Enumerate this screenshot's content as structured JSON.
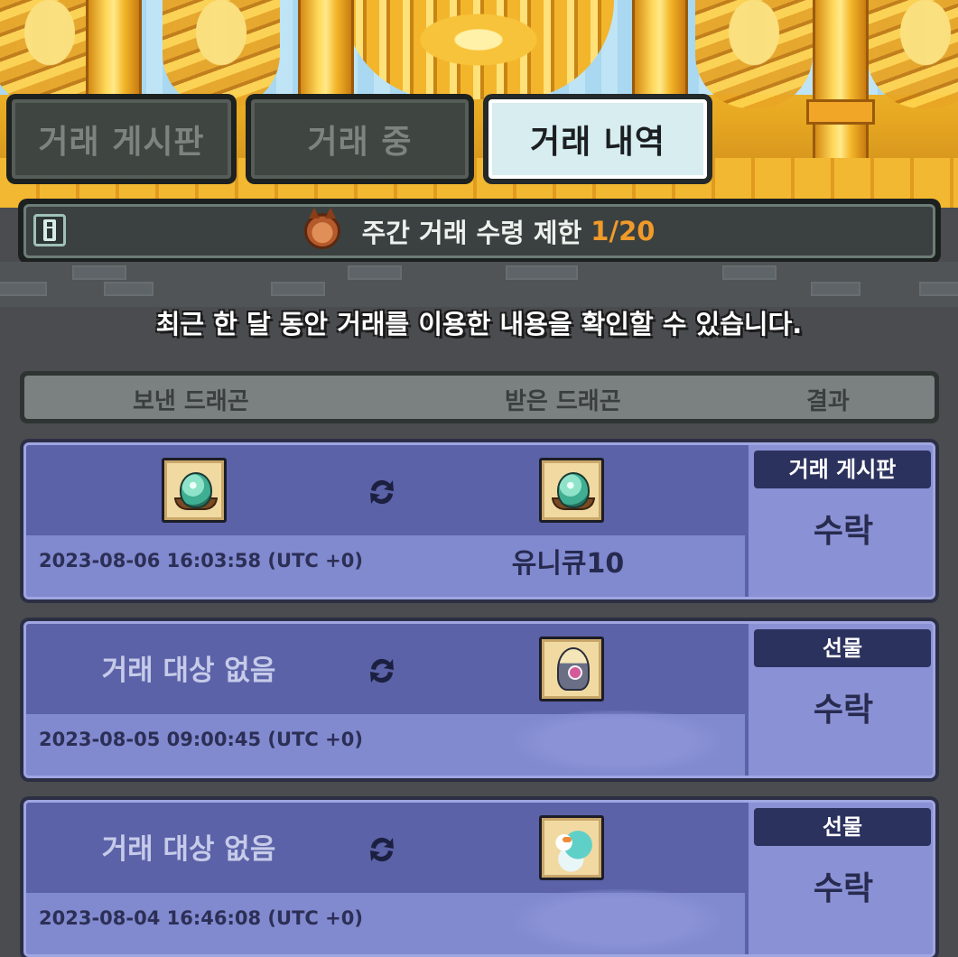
{
  "tabs": [
    {
      "label": "거래 게시판",
      "active": false
    },
    {
      "label": "거래 중",
      "active": false
    },
    {
      "label": "거래 내역",
      "active": true
    }
  ],
  "weekly_limit": {
    "label": "주간 거래 수령 제한",
    "value": "1/20",
    "value_color": "#f19a2a"
  },
  "notice": "최근 한 달 동안 거래를 이용한 내용을 확인할 수 있습니다.",
  "table_header": {
    "sent": "보낸 드래곤",
    "received": "받은 드래곤",
    "result": "결과"
  },
  "rows": [
    {
      "sent_icon": "dragon-egg-icon",
      "sent_label": "",
      "received_icon": "dragon-egg-icon",
      "received_name": "유니큐10",
      "date": "2023-08-06 16:03:58 (UTC +0)",
      "type": "거래 게시판",
      "result": "수락"
    },
    {
      "sent_icon": "",
      "sent_label": "거래 대상 없음",
      "received_icon": "owl-dragon-icon",
      "received_name": "",
      "date": "2023-08-05 09:00:45 (UTC +0)",
      "type": "선물",
      "result": "수락"
    },
    {
      "sent_icon": "",
      "sent_label": "거래 대상 없음",
      "received_icon": "teal-pony-dragon-icon",
      "received_name": "",
      "date": "2023-08-04 16:46:08 (UTC +0)",
      "type": "선물",
      "result": "수락"
    }
  ],
  "colors": {
    "row_bg": "#8189cf",
    "row_top": "#5b62a8",
    "badge_bg": "#2c325e",
    "tab_active_bg": "#d7edf0"
  }
}
